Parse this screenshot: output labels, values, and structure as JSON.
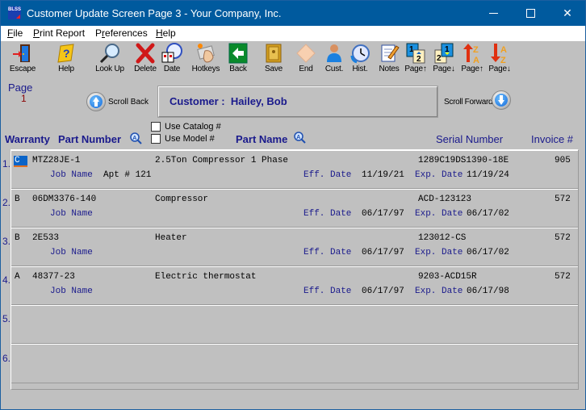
{
  "window": {
    "title": "Customer Update Screen Page 3 - Your Company, Inc.",
    "app_icon_text": "BLSS",
    "controls": {
      "minimize": "minimize",
      "maximize": "maximize",
      "close": "✕"
    }
  },
  "menubar": {
    "items": [
      {
        "label": "File",
        "accel": "F",
        "rest": "ile"
      },
      {
        "label": "Print Report",
        "accel": "P",
        "rest": "rint Report"
      },
      {
        "label": "Preferences",
        "pre": "P",
        "accel": "r",
        "rest": "eferences"
      },
      {
        "label": "Help",
        "accel": "H",
        "rest": "elp"
      }
    ]
  },
  "toolbar": {
    "items": [
      {
        "id": "escape",
        "label": "Escape",
        "icon": "door-exit-icon"
      },
      {
        "id": "help",
        "label": "Help",
        "icon": "help-book-icon"
      },
      {
        "id": "lookup",
        "label": "Look Up",
        "icon": "magnifier-icon"
      },
      {
        "id": "delete",
        "label": "Delete",
        "icon": "red-x-icon"
      },
      {
        "id": "date",
        "label": "Date",
        "icon": "calendar-clock-icon"
      },
      {
        "id": "hotkeys",
        "label": "Hotkeys",
        "icon": "hotkeys-hand-icon"
      },
      {
        "id": "back",
        "label": "Back",
        "icon": "back-arrow-icon"
      },
      {
        "id": "save",
        "label": "Save",
        "icon": "safe-icon"
      },
      {
        "id": "end",
        "label": "End",
        "icon": "eraser-icon"
      },
      {
        "id": "cust",
        "label": "Cust.",
        "icon": "customer-person-icon"
      },
      {
        "id": "hist",
        "label": "Hist.",
        "icon": "history-clock-icon"
      },
      {
        "id": "notes",
        "label": "Notes",
        "icon": "notepad-pencil-icon"
      },
      {
        "id": "page-up",
        "label": "Page↑",
        "icon": "page-up-icon"
      },
      {
        "id": "page-down",
        "label": "Page↓",
        "icon": "page-down-icon"
      },
      {
        "id": "sort-up",
        "label": "Page↑",
        "icon": "sort-za-up-icon"
      },
      {
        "id": "sort-down",
        "label": "Page↓",
        "icon": "sort-az-down-icon"
      }
    ]
  },
  "page": {
    "label": "Page",
    "number": "1"
  },
  "scroll": {
    "back_label": "Scroll Back",
    "forward_label": "Scroll Forward"
  },
  "customer": {
    "label": "Customer :",
    "name": "Hailey, Bob"
  },
  "columns": {
    "warranty": "Warranty",
    "part_number": "Part Number",
    "part_name": "Part Name",
    "serial_number": "Serial Number",
    "invoice": "Invoice #"
  },
  "options": {
    "use_catalog": {
      "label": "Use Catalog #",
      "checked": false
    },
    "use_model": {
      "label": "Use Model #",
      "checked": false
    }
  },
  "labels": {
    "job_name": "Job Name",
    "eff_date": "Eff. Date",
    "exp_date": "Exp. Date"
  },
  "rows": [
    {
      "index": "1.",
      "warranty": "C",
      "part_number": "MTZ28JE-1",
      "part_name": "2.5Ton Compressor 1 Phase",
      "serial": "1289C19DS1390-18E",
      "invoice": "905",
      "job_name": "Apt # 121",
      "eff_date": "11/19/21",
      "exp_date": "11/19/24",
      "selected": true
    },
    {
      "index": "2.",
      "warranty": "B",
      "part_number": "06DM3376-140",
      "part_name": "Compressor",
      "serial": "ACD-123123",
      "invoice": "572",
      "job_name": "",
      "eff_date": "06/17/97",
      "exp_date": "06/17/02"
    },
    {
      "index": "3.",
      "warranty": "B",
      "part_number": "2E533",
      "part_name": "Heater",
      "serial": "123012-CS",
      "invoice": "572",
      "job_name": "",
      "eff_date": "06/17/97",
      "exp_date": "06/17/02"
    },
    {
      "index": "4.",
      "warranty": "A",
      "part_number": "48377-23",
      "part_name": "Electric thermostat",
      "serial": "9203-ACD15R",
      "invoice": "572",
      "job_name": "",
      "eff_date": "06/17/97",
      "exp_date": "06/17/98"
    },
    {
      "index": "5.",
      "empty": true
    },
    {
      "index": "6.",
      "empty": true
    }
  ],
  "colors": {
    "titlebar": "#005a9e",
    "label_blue": "#1a1a8c",
    "selection": "#0a64c8",
    "page_number": "#8b0000",
    "background": "#c0c0c0"
  }
}
